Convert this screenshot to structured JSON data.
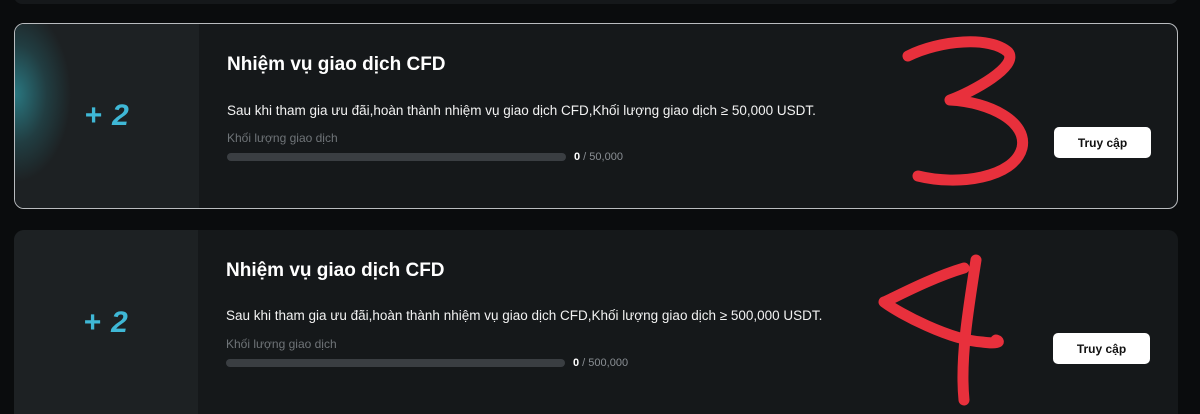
{
  "tasks": [
    {
      "reward": "+ 2",
      "title": "Nhiệm vụ giao dịch CFD",
      "description": "Sau khi tham gia ưu đãi,hoàn thành nhiệm vụ giao dịch CFD,Khối lượng giao dịch ≥ 50,000 USDT.",
      "progress_label": "Khối lượng giao dịch",
      "progress_current": "0",
      "progress_total": " / 50,000",
      "progress_fraction": 0,
      "button_label": "Truy cập",
      "annotation": "3"
    },
    {
      "reward": "+ 2",
      "title": "Nhiệm vụ giao dịch CFD",
      "description": "Sau khi tham gia ưu đãi,hoàn thành nhiệm vụ giao dịch CFD,Khối lượng giao dịch ≥ 500,000 USDT.",
      "progress_label": "Khối lượng giao dịch",
      "progress_current": "0",
      "progress_total": " / 500,000",
      "progress_fraction": 0,
      "button_label": "Truy cập",
      "annotation": "4"
    }
  ],
  "colors": {
    "accent": "#3fb8d6",
    "annotation": "#e8303c",
    "card_bg": "#15181a",
    "page_bg": "#0a0c0d"
  }
}
